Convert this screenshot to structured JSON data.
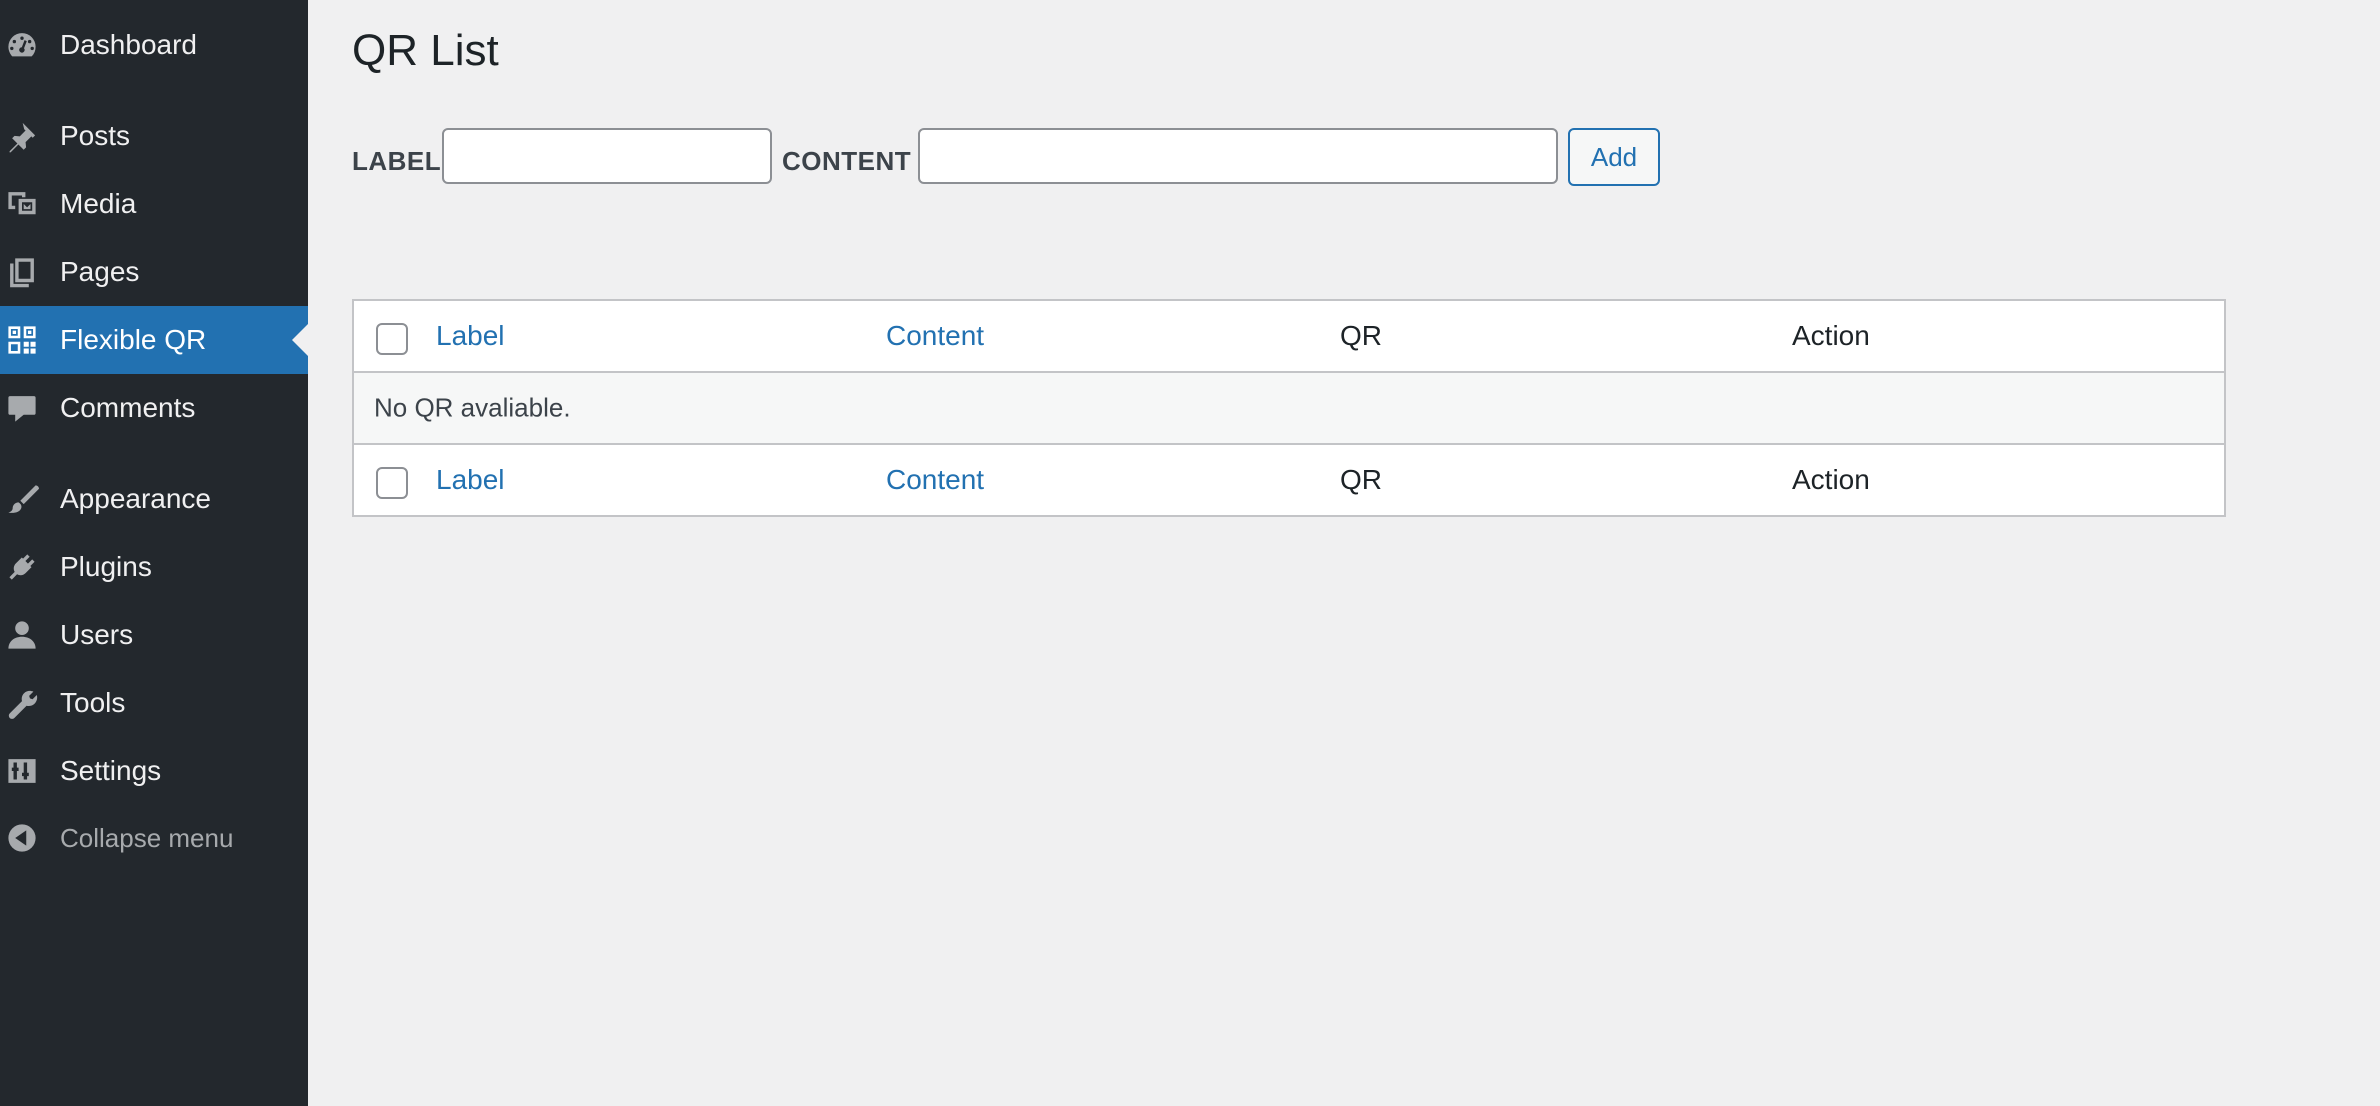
{
  "sidebar": {
    "items": [
      {
        "label": "Dashboard",
        "icon": "dashboard-icon"
      },
      {
        "label": "Posts",
        "icon": "pin-icon"
      },
      {
        "label": "Media",
        "icon": "media-icon"
      },
      {
        "label": "Pages",
        "icon": "pages-icon"
      },
      {
        "label": "Flexible QR",
        "icon": "qr-code-icon",
        "active": true
      },
      {
        "label": "Comments",
        "icon": "comment-icon"
      },
      {
        "label": "Appearance",
        "icon": "paintbrush-icon"
      },
      {
        "label": "Plugins",
        "icon": "plug-icon"
      },
      {
        "label": "Users",
        "icon": "user-icon"
      },
      {
        "label": "Tools",
        "icon": "wrench-icon"
      },
      {
        "label": "Settings",
        "icon": "settings-sliders-icon"
      },
      {
        "label": "Collapse menu",
        "icon": "collapse-arrow-icon"
      }
    ]
  },
  "page": {
    "title": "QR List"
  },
  "form": {
    "label_text": "LABEL",
    "label_value": "",
    "content_text": "CONTENT",
    "content_value": "",
    "add_button": "Add"
  },
  "table": {
    "columns": [
      "Label",
      "Content",
      "QR",
      "Action"
    ],
    "empty_message": "No QR avaliable."
  },
  "colors": {
    "sidebar_bg": "#23282d",
    "accent": "#2271b1",
    "page_bg": "#f0f0f1"
  }
}
